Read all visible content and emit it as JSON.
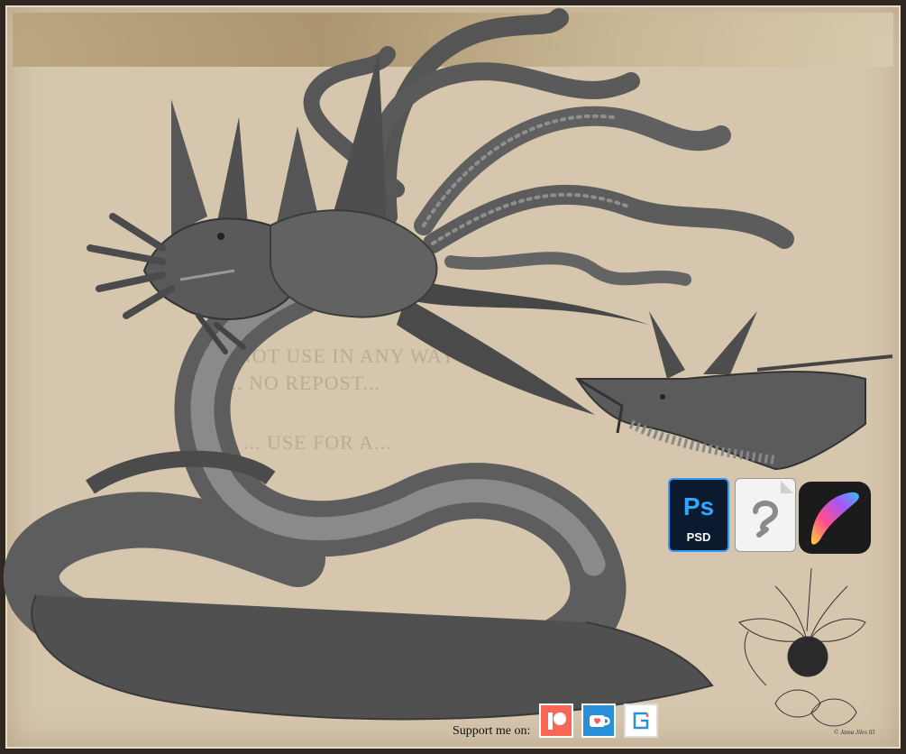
{
  "watermark": {
    "line1": "D... NOT USE IN ANY WAY",
    "line2": "... NO REPOST...",
    "line3": "... USE FOR A..."
  },
  "tools": {
    "photoshop_big": "Ps",
    "photoshop_small": "PSD",
    "clip_studio_icon": "clip-studio-file-icon",
    "procreate_icon": "procreate-brush-icon"
  },
  "support": {
    "label": "Support me on:",
    "patreon_icon": "patreon-icon",
    "kofi_icon": "kofi-cup-icon",
    "gumroad_icon": "gumroad-icon"
  },
  "signature": {
    "text": "© Jama Jiles 03"
  },
  "colors": {
    "parchment": "#d5c6ad",
    "frame": "#2f2822",
    "creature_dark": "#4a4a4a",
    "creature_mid": "#6b6b6b",
    "creature_light": "#9a9a9a",
    "patreon": "#f96854",
    "kofi": "#2a8fd6",
    "ps_blue": "#31a8ff"
  }
}
